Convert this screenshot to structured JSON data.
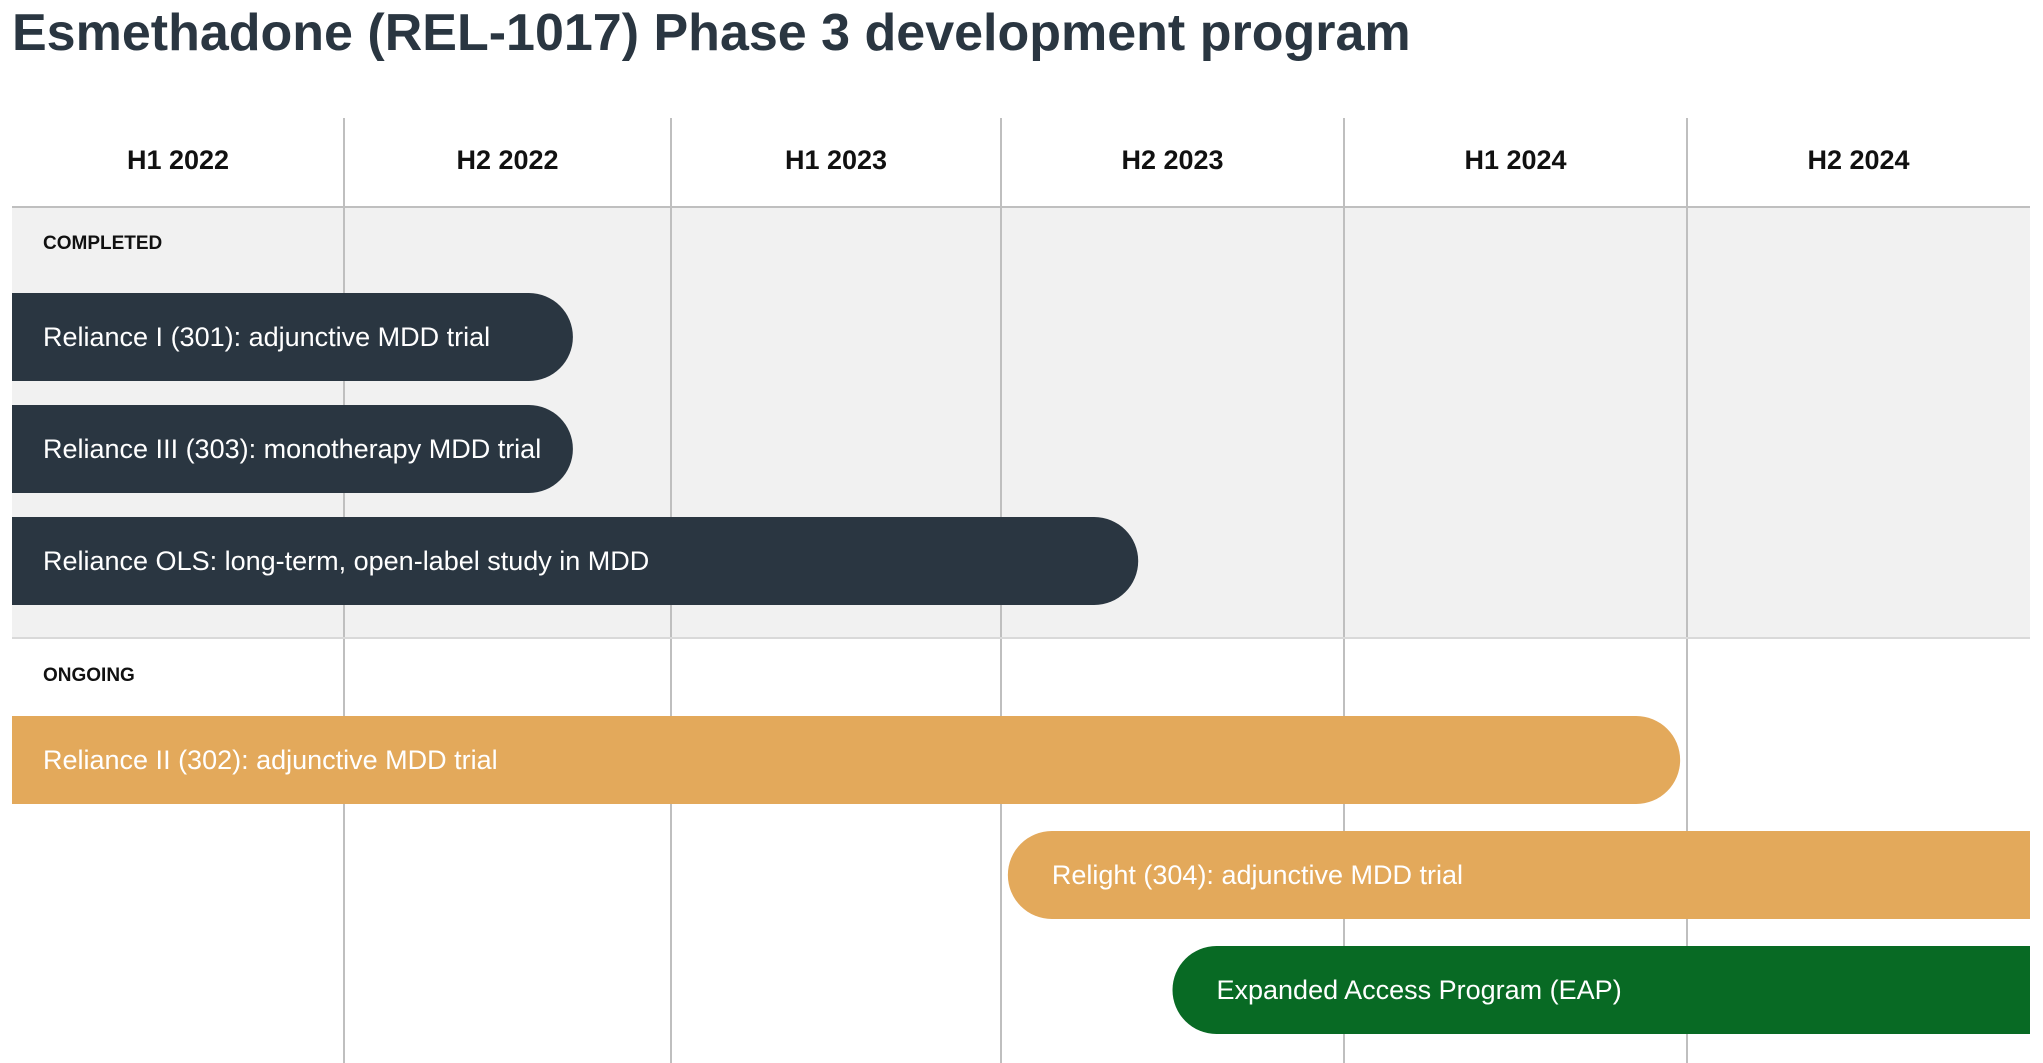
{
  "title": "Esmethadone (REL-1017) Phase 3 development program",
  "chart_data": {
    "type": "gantt",
    "periods": [
      "H1 2022",
      "H2 2022",
      "H1 2023",
      "H2 2023",
      "H1 2024",
      "H2 2024"
    ],
    "groups": [
      {
        "name": "COMPLETED",
        "tasks": [
          {
            "label": "Reliance I (301): adjunctive MDD trial",
            "start": 0.0,
            "end": 1.7
          },
          {
            "label": "Reliance III (303): monotherapy MDD trial",
            "start": 0.0,
            "end": 1.7
          },
          {
            "label": "Reliance OLS: long-term, open-label study in MDD",
            "start": 0.0,
            "end": 3.4
          }
        ]
      },
      {
        "name": "ONGOING",
        "tasks": [
          {
            "label": "Reliance II (302): adjunctive MDD trial",
            "start": 0.0,
            "end": 4.98
          },
          {
            "label": "Relight (304): adjunctive MDD trial",
            "start": 3.02,
            "end": 6.0
          },
          {
            "label": "Expanded Access Program (EAP)",
            "start": 3.5,
            "end": 6.0
          }
        ]
      }
    ],
    "colors": {
      "completed": "#2a3641",
      "ongoing": "#e3a95b",
      "eap": "#086a24",
      "completed_band": "#f1f1f1",
      "gridline": "#bfbfbf"
    }
  }
}
